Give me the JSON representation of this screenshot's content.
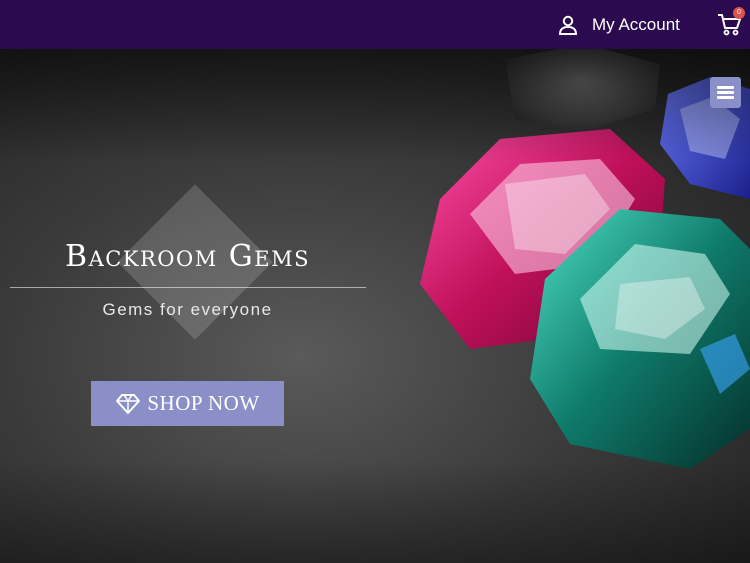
{
  "header": {
    "account_label": "My Account",
    "account_icon": "user-icon",
    "cart_icon": "cart-icon",
    "cart_count": "0",
    "background_color": "#2b0a4f"
  },
  "hero": {
    "brand_title": "Backroom Gems",
    "tagline": "Gems for everyone",
    "shop_button_label": "SHOP NOW",
    "shop_button_icon": "diamond-icon",
    "menu_icon": "hamburger-menu-icon",
    "accent_color": "#8a8fc8"
  }
}
